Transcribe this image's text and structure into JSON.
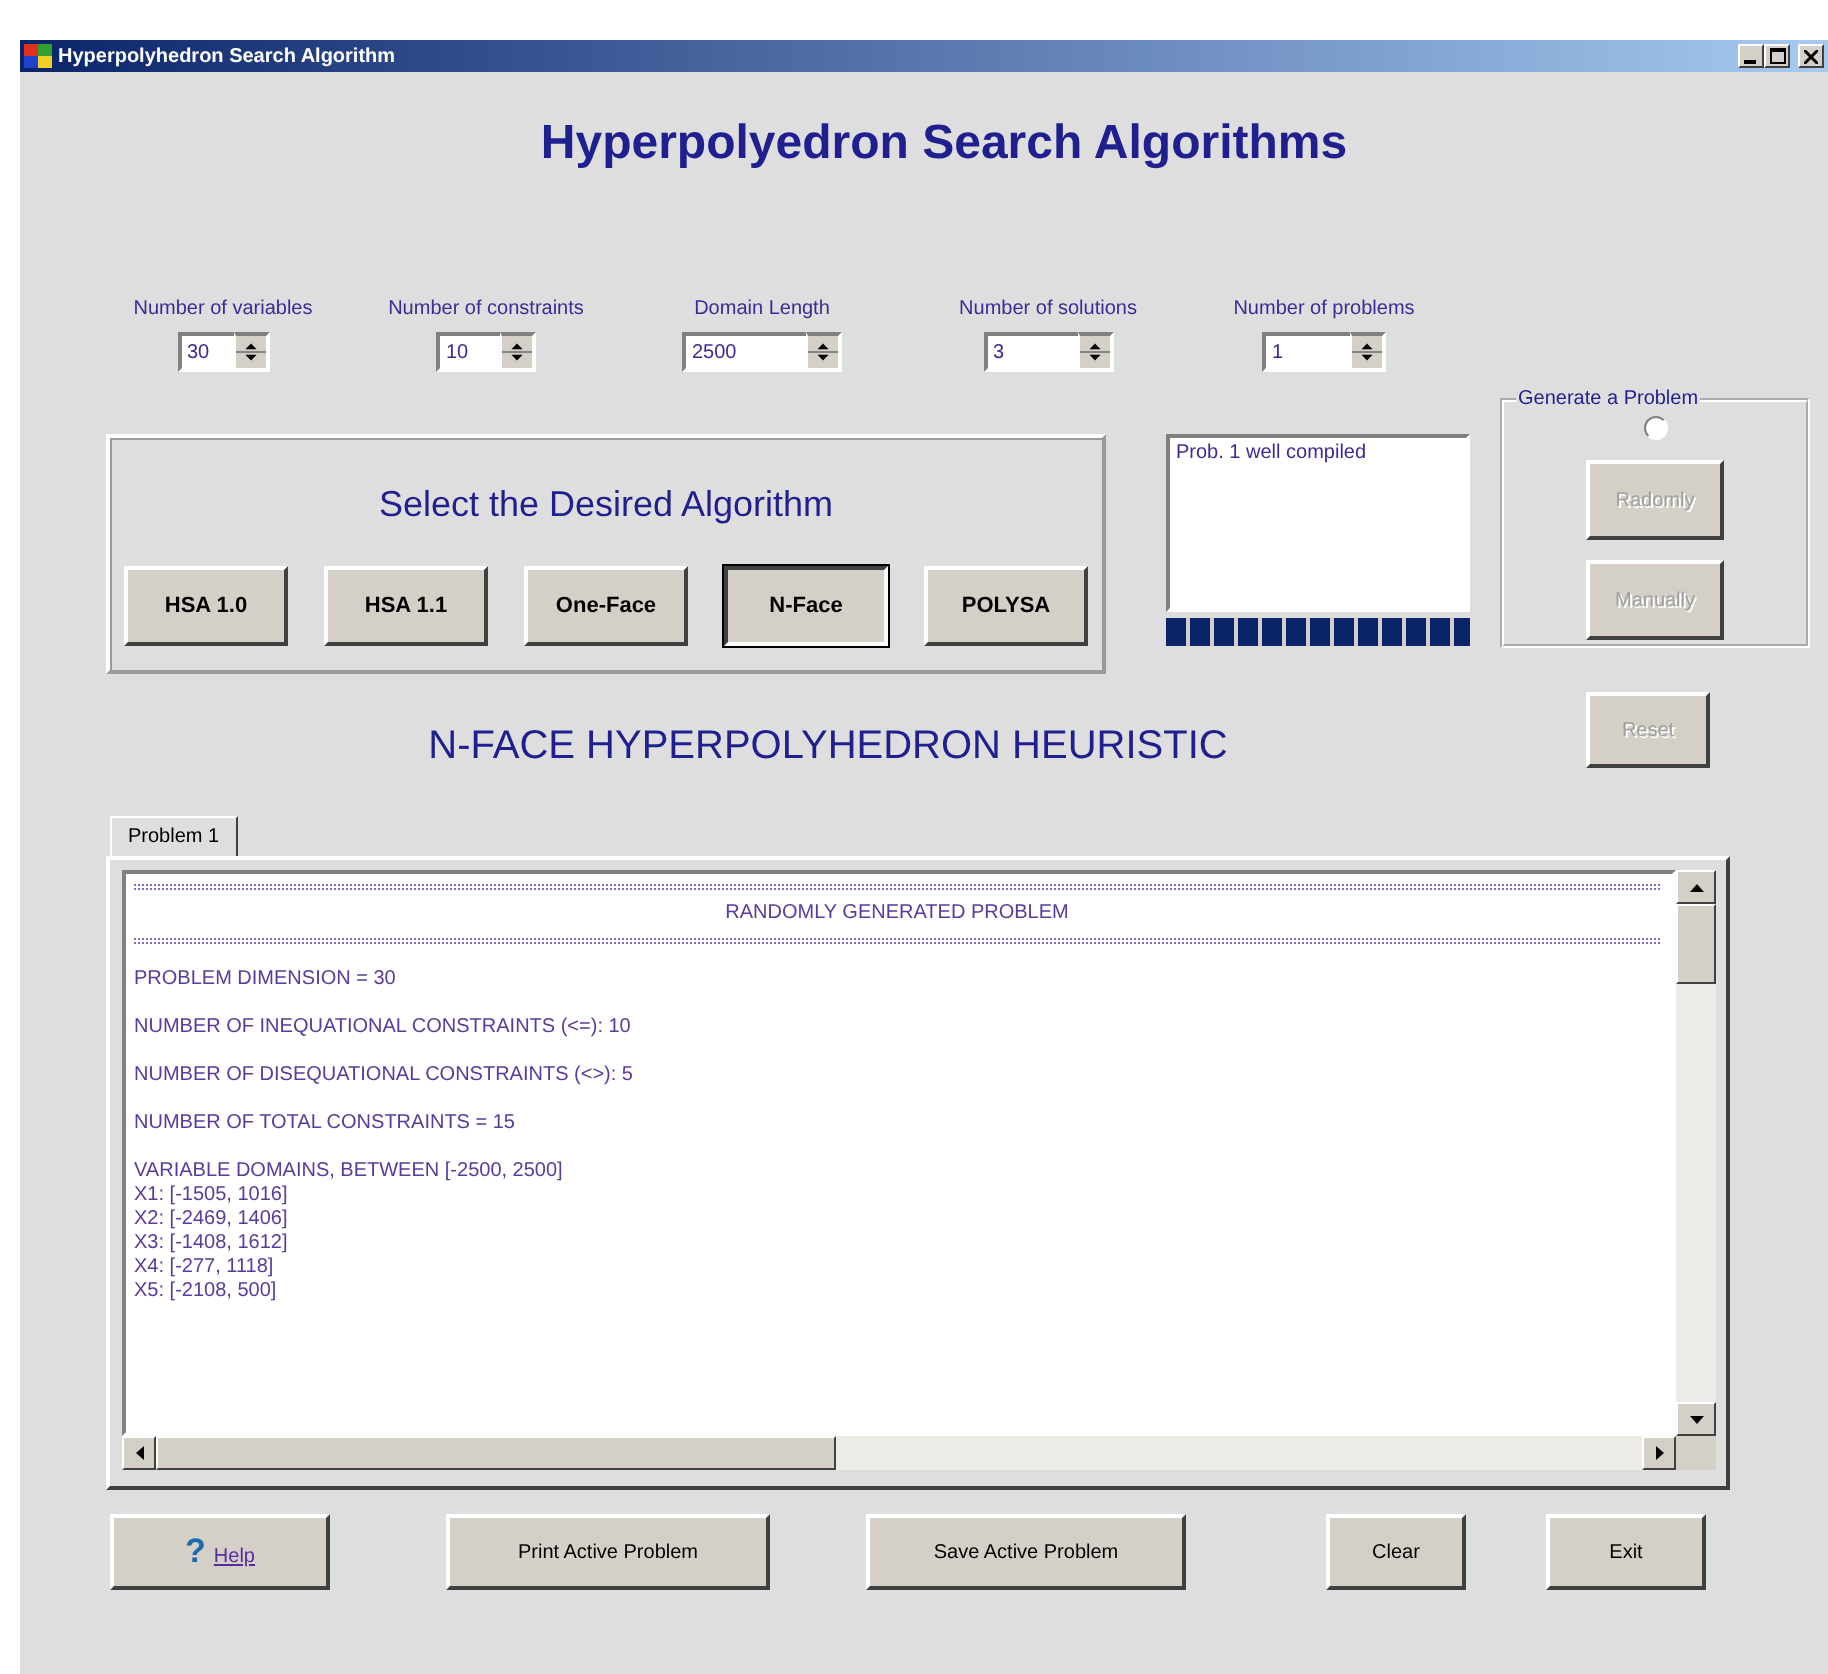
{
  "window": {
    "title": "Hyperpolyhedron Search Algorithm"
  },
  "heading": "Hyperpolyedron Search Algorithms",
  "parameters": [
    {
      "label": "Number of variables",
      "value": "30"
    },
    {
      "label": "Number of constraints",
      "value": "10"
    },
    {
      "label": "Domain Length",
      "value": "2500"
    },
    {
      "label": "Number of solutions",
      "value": "3"
    },
    {
      "label": "Number of problems",
      "value": "1"
    }
  ],
  "algorithm_group": {
    "title": "Select the Desired Algorithm",
    "buttons": [
      {
        "label": "HSA 1.0",
        "selected": false
      },
      {
        "label": "HSA 1.1",
        "selected": false
      },
      {
        "label": "One-Face",
        "selected": false
      },
      {
        "label": "N-Face",
        "selected": true
      },
      {
        "label": "POLYSA",
        "selected": false
      }
    ]
  },
  "status": {
    "messages": [
      "Prob. 1 well compiled"
    ],
    "level": 1
  },
  "generate_group": {
    "title": "Generate a Problem",
    "radio_checked": false,
    "buttons": [
      {
        "label": "Radomly",
        "disabled": true
      },
      {
        "label": "Manually",
        "disabled": true
      }
    ]
  },
  "reset_button": {
    "label": "Reset",
    "disabled": true
  },
  "algorithm_heading": "N-FACE HYPERPOLYHEDRON HEURISTIC",
  "tabs": [
    {
      "label": "Problem 1",
      "selected": true
    }
  ],
  "output": {
    "lines": [
      {
        "kind": "rule"
      },
      {
        "kind": "title",
        "text": "RANDOMLY GENERATED PROBLEM"
      },
      {
        "kind": "rule"
      },
      {
        "kind": "spaced",
        "text": "PROBLEM DIMENSION = 30"
      },
      {
        "kind": "spaced",
        "text": "NUMBER OF INEQUATIONAL CONSTRAINTS (<=): 10"
      },
      {
        "kind": "spaced",
        "text": "NUMBER OF DISEQUATIONAL CONSTRAINTS (<>): 5"
      },
      {
        "kind": "spaced",
        "text": "NUMBER OF TOTAL CONSTRAINTS = 15"
      },
      {
        "kind": "spaced",
        "text": "VARIABLE DOMAINS, BETWEEN [-2500, 2500]"
      },
      {
        "kind": "plain",
        "text": "X1: [-1505, 1016]"
      },
      {
        "kind": "plain",
        "text": "X2: [-2469, 1406]"
      },
      {
        "kind": "plain",
        "text": "X3: [-1408, 1612]"
      },
      {
        "kind": "plain",
        "text": "X4: [-277, 1118]"
      },
      {
        "kind": "plain",
        "text": "X5: [-2108, 500]"
      }
    ]
  },
  "buttons": [
    {
      "label": "Help",
      "kind": "help",
      "icon": "?"
    },
    {
      "label": "Print Active Problem",
      "kind": "plain"
    },
    {
      "label": "Save Active Problem",
      "kind": "plain"
    },
    {
      "label": "Clear",
      "kind": "plain"
    },
    {
      "label": "Exit",
      "kind": "plain"
    }
  ]
}
